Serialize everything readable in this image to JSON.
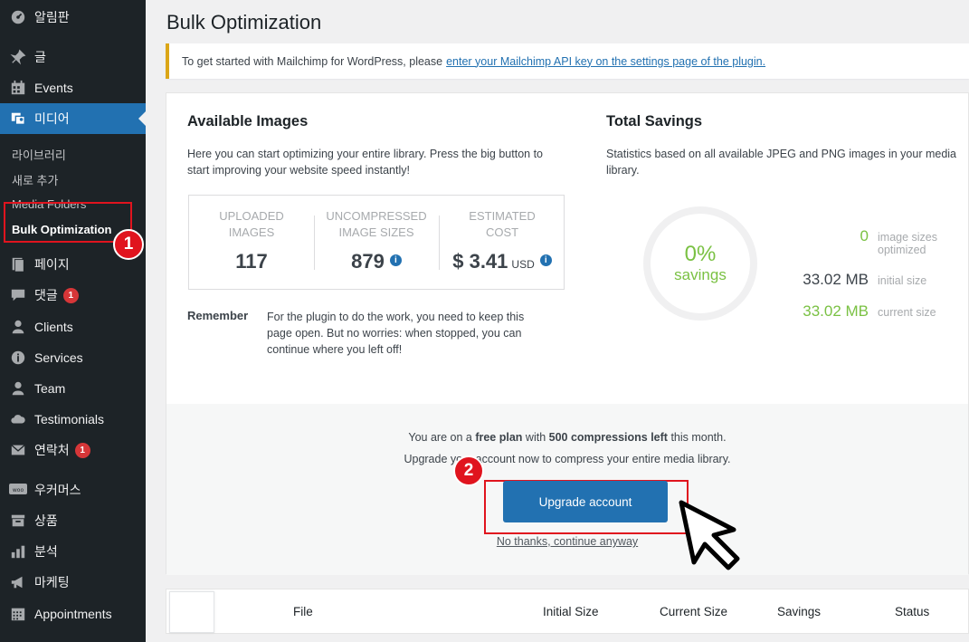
{
  "sidebar": {
    "items": [
      {
        "label": "알림판",
        "icon": "dashboard-icon"
      },
      {
        "label": "글",
        "icon": "pin-icon"
      },
      {
        "label": "Events",
        "icon": "calendar-icon"
      },
      {
        "label": "미디어",
        "icon": "media-icon"
      },
      {
        "label": "페이지",
        "icon": "page-icon"
      },
      {
        "label": "댓글",
        "icon": "comment-icon",
        "badge": "1"
      },
      {
        "label": "Clients",
        "icon": "user-icon"
      },
      {
        "label": "Services",
        "icon": "info-icon"
      },
      {
        "label": "Team",
        "icon": "user-icon"
      },
      {
        "label": "Testimonials",
        "icon": "cloud-icon"
      },
      {
        "label": "연락처",
        "icon": "mail-icon",
        "badge": "1"
      },
      {
        "label": "우커머스",
        "icon": "woo-icon"
      },
      {
        "label": "상품",
        "icon": "archive-icon"
      },
      {
        "label": "분석",
        "icon": "chart-icon"
      },
      {
        "label": "마케팅",
        "icon": "megaphone-icon"
      },
      {
        "label": "Appointments",
        "icon": "calendar-grid-icon"
      }
    ],
    "submenu": [
      "라이브러리",
      "새로 추가",
      "Media Folders",
      "Bulk Optimization"
    ]
  },
  "page": {
    "title": "Bulk Optimization"
  },
  "notice": {
    "text": "To get started with Mailchimp for WordPress, please",
    "link": "enter your Mailchimp API key on the settings page of the plugin."
  },
  "available": {
    "title": "Available Images",
    "desc1": "Here you can start optimizing your entire library. Press the big button to",
    "desc2": "start improving your website speed instantly!",
    "stats": [
      {
        "label1": "UPLOADED",
        "label2": "IMAGES",
        "value": "117",
        "unit": ""
      },
      {
        "label1": "UNCOMPRESSED",
        "label2": "IMAGE SIZES",
        "value": "879",
        "unit": ""
      },
      {
        "label1": "ESTIMATED",
        "label2": "COST",
        "value": "$ 3.41",
        "unit": "USD"
      }
    ],
    "remember_label": "Remember",
    "remember1": "For the plugin to do the work, you need to keep this",
    "remember2": "page open. But no worries: when stopped, you can",
    "remember3": "continue where you left off!"
  },
  "savings": {
    "title": "Total Savings",
    "desc1": "Statistics based on all available JPEG and PNG images in your media",
    "desc2": "library.",
    "percent": "0%",
    "percent_label": "savings",
    "rows": [
      {
        "value": "0",
        "label1": "image sizes",
        "label2": "optimized"
      },
      {
        "value": "33.02 MB",
        "label1": "initial size",
        "label2": ""
      },
      {
        "value": "33.02 MB",
        "label1": "current size",
        "label2": ""
      }
    ]
  },
  "plan": {
    "p1": "You are on a",
    "p2": "free plan",
    "p3": "with",
    "p4": "500 compressions left",
    "p5": "this month.",
    "upgrade_text": "Upgrade your account now to compress your entire media library.",
    "button": "Upgrade account",
    "no_thanks": "No thanks, continue anyway"
  },
  "table": {
    "headers": [
      "File",
      "Initial Size",
      "Current Size",
      "Savings",
      "Status"
    ]
  },
  "annotations": {
    "step1": "1",
    "step2": "2"
  },
  "colors": {
    "sidebar": "#1d2327",
    "accent": "#2271b1",
    "green": "#7ac143",
    "highlight": "#e0141e",
    "notice_border": "#dba617"
  }
}
